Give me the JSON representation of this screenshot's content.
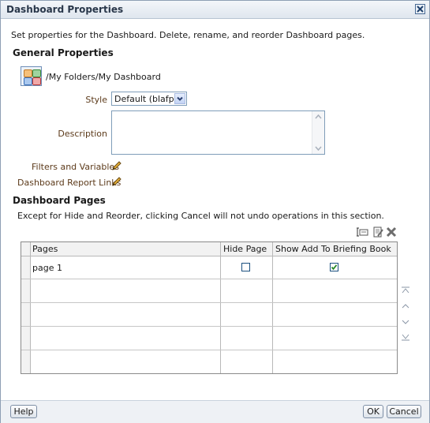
{
  "dialog": {
    "title": "Dashboard Properties",
    "intro": "Set properties for the Dashboard. Delete, rename, and reorder Dashboard pages."
  },
  "general": {
    "heading": "General Properties",
    "path": "/My Folders/My Dashboard",
    "style_label": "Style",
    "style_value": "Default (blafp)",
    "description_label": "Description",
    "description_value": "",
    "filters_link": "Filters and Variables",
    "report_links": "Dashboard Report Links"
  },
  "pages": {
    "heading": "Dashboard Pages",
    "note": "Except for Hide and Reorder, clicking Cancel will not undo operations in this section.",
    "columns": [
      "Pages",
      "Hide Page",
      "Show Add To Briefing Book"
    ],
    "rows": [
      {
        "name": "page 1",
        "hide": false,
        "briefing": true
      },
      {
        "name": "",
        "hide": null,
        "briefing": null
      },
      {
        "name": "",
        "hide": null,
        "briefing": null
      },
      {
        "name": "",
        "hide": null,
        "briefing": null
      },
      {
        "name": "",
        "hide": null,
        "briefing": null
      }
    ]
  },
  "footer": {
    "help": "Help",
    "ok": "OK",
    "cancel": "Cancel"
  },
  "colors": {
    "titlebar": "#dfe6ee",
    "label": "#5c3a1a",
    "check": "#2a8a2a"
  }
}
